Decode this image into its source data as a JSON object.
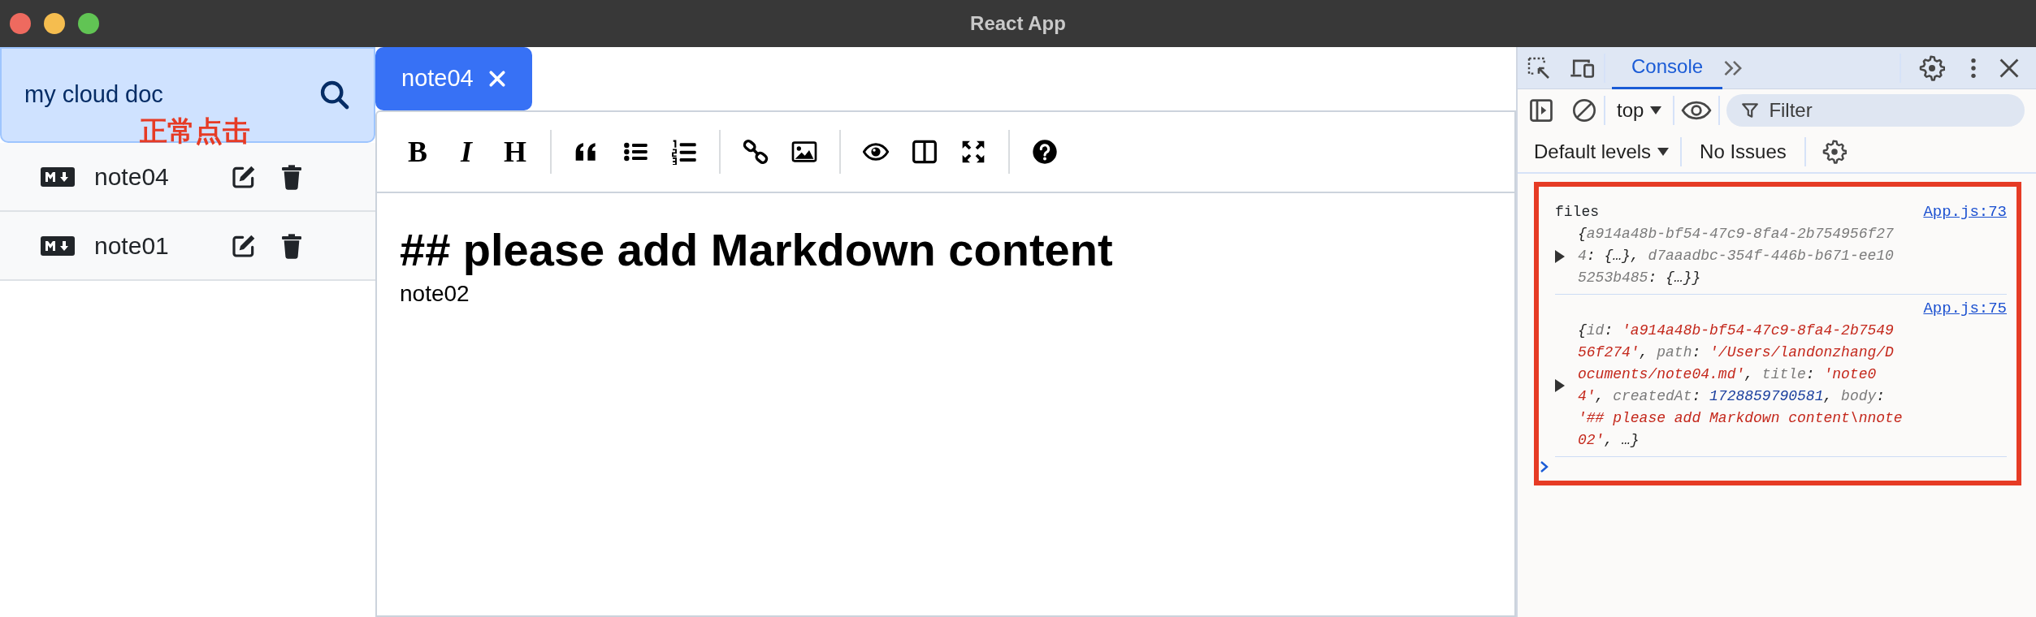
{
  "window": {
    "title": "React App"
  },
  "sidebar": {
    "search": {
      "title": "my cloud doc"
    },
    "files": [
      {
        "title": "note04"
      },
      {
        "title": "note01"
      }
    ]
  },
  "annotation": {
    "text": "正常点击"
  },
  "editor": {
    "tabs": [
      {
        "title": "note04",
        "selected": true
      }
    ],
    "toolbar": [
      [
        {
          "kind": "bold",
          "label": "B"
        },
        {
          "kind": "italic",
          "label": "I"
        },
        {
          "kind": "heading",
          "label": "H"
        }
      ],
      [
        {
          "kind": "quote"
        },
        {
          "kind": "unordered-list"
        },
        {
          "kind": "ordered-list"
        }
      ],
      [
        {
          "kind": "link"
        },
        {
          "kind": "image"
        }
      ],
      [
        {
          "kind": "preview"
        },
        {
          "kind": "side-by-side"
        },
        {
          "kind": "fullscreen"
        }
      ],
      [
        {
          "kind": "guide"
        }
      ]
    ],
    "content": {
      "heading": "## please add Markdown content",
      "body": "note02"
    }
  },
  "devtools": {
    "tabs": [
      {
        "label": "Console",
        "selected": true
      }
    ],
    "context": "top",
    "filter": {
      "placeholder": "Filter"
    },
    "levels": "Default levels",
    "issues": "No Issues",
    "messages": [
      {
        "label": "files",
        "source": "App.js:73",
        "tokens": [
          {
            "kind": "punct",
            "text": "{"
          },
          {
            "kind": "key",
            "text": "a914a48b-bf54-47c9-8fa4-2b754956f274"
          },
          {
            "kind": "punct",
            "text": ": {…}, "
          },
          {
            "kind": "key",
            "text": "d7aaadbc-354f-446b-b671-ee105253b485"
          },
          {
            "kind": "punct",
            "text": ": {…}}"
          }
        ]
      },
      {
        "source": "App.js:75",
        "tokens": [
          {
            "kind": "punct",
            "text": "{"
          },
          {
            "kind": "key",
            "text": "id"
          },
          {
            "kind": "punct",
            "text": ": "
          },
          {
            "kind": "string",
            "text": "'a914a48b-bf54-47c9-8fa4-2b754956f274'"
          },
          {
            "kind": "punct",
            "text": ", "
          },
          {
            "kind": "key",
            "text": "path"
          },
          {
            "kind": "punct",
            "text": ": "
          },
          {
            "kind": "string",
            "text": "'/Users/landonzhang/Documents/note04.md'"
          },
          {
            "kind": "punct",
            "text": ", "
          },
          {
            "kind": "key",
            "text": "title"
          },
          {
            "kind": "punct",
            "text": ": "
          },
          {
            "kind": "string",
            "text": "'note04'"
          },
          {
            "kind": "punct",
            "text": ", "
          },
          {
            "kind": "key",
            "text": "createdAt"
          },
          {
            "kind": "punct",
            "text": ": "
          },
          {
            "kind": "number",
            "text": "1728859790581"
          },
          {
            "kind": "punct",
            "text": ", "
          },
          {
            "kind": "key",
            "text": "body"
          },
          {
            "kind": "punct",
            "text": ": "
          },
          {
            "kind": "string",
            "text": "'## please add Markdown content\\nnote02'"
          },
          {
            "kind": "punct",
            "text": ", …}"
          }
        ]
      }
    ]
  }
}
